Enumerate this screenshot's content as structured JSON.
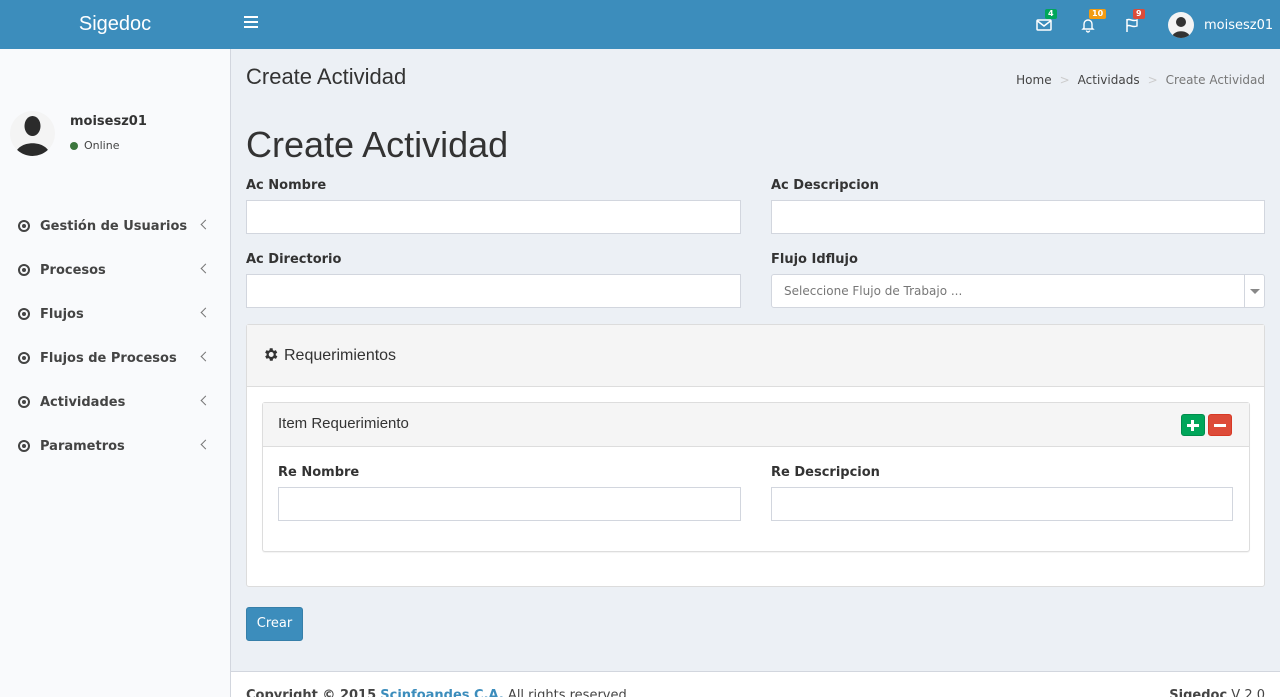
{
  "app": {
    "logo": "Sigedoc"
  },
  "header": {
    "messages_count": "4",
    "notifications_count": "10",
    "tasks_count": "9",
    "username": "moisesz01"
  },
  "sidebar": {
    "user_name": "moisesz01",
    "status": "Online",
    "items": [
      {
        "label": "Gestión de Usuarios"
      },
      {
        "label": "Procesos"
      },
      {
        "label": "Flujos"
      },
      {
        "label": "Flujos de Procesos"
      },
      {
        "label": "Actividades"
      },
      {
        "label": "Parametros"
      }
    ]
  },
  "content": {
    "page_title": "Create Actividad",
    "breadcrumb": [
      "Home",
      "Actividads",
      "Create Actividad"
    ],
    "form_title": "Create Actividad",
    "fields": {
      "ac_nombre": {
        "label": "Ac Nombre",
        "value": ""
      },
      "ac_descripcion": {
        "label": "Ac Descripcion",
        "value": ""
      },
      "ac_directorio": {
        "label": "Ac Directorio",
        "value": ""
      },
      "flujo_idflujo": {
        "label": "Flujo Idflujo",
        "placeholder": "Seleccione Flujo de Trabajo ..."
      }
    },
    "requerimientos": {
      "title": "Requerimientos",
      "item_title": "Item Requerimiento",
      "re_nombre": {
        "label": "Re Nombre",
        "value": ""
      },
      "re_descripcion": {
        "label": "Re Descripcion",
        "value": ""
      }
    },
    "submit_label": "Crear"
  },
  "footer": {
    "copyright": "Copyright © 2015",
    "company": "Scinfoandes C.A.",
    "rights": "All rights reserved.",
    "product": "Sigedoc",
    "version": "V 2.0"
  },
  "colors": {
    "header": "#3c8dbc",
    "success": "#00a65a",
    "danger": "#dd4b39",
    "warning": "#f39c12"
  }
}
